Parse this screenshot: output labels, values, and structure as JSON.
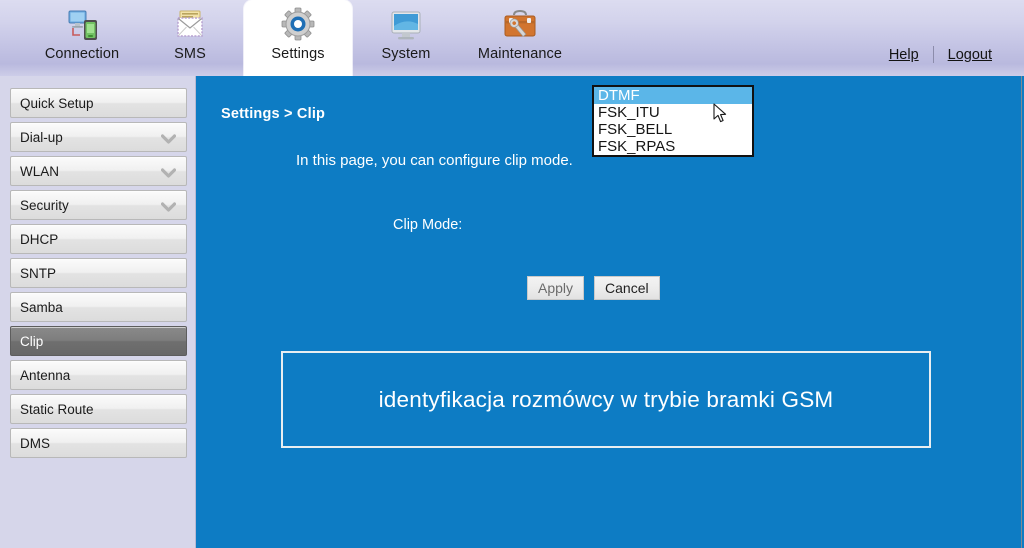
{
  "header": {
    "tabs": [
      {
        "label": "Connection",
        "icon": "network-devices-icon",
        "active": false
      },
      {
        "label": "SMS",
        "icon": "envelope-icon",
        "active": false
      },
      {
        "label": "Settings",
        "icon": "gear-icon",
        "active": true
      },
      {
        "label": "System",
        "icon": "monitor-icon",
        "active": false
      },
      {
        "label": "Maintenance",
        "icon": "toolbox-wrench-icon",
        "active": false
      }
    ],
    "help_label": "Help",
    "logout_label": "Logout"
  },
  "sidebar": {
    "items": [
      {
        "label": "Quick Setup",
        "expandable": false,
        "active": false
      },
      {
        "label": "Dial-up",
        "expandable": true,
        "active": false
      },
      {
        "label": "WLAN",
        "expandable": true,
        "active": false
      },
      {
        "label": "Security",
        "expandable": true,
        "active": false
      },
      {
        "label": "DHCP",
        "expandable": false,
        "active": false
      },
      {
        "label": "SNTP",
        "expandable": false,
        "active": false
      },
      {
        "label": "Samba",
        "expandable": false,
        "active": false
      },
      {
        "label": "Clip",
        "expandable": false,
        "active": true
      },
      {
        "label": "Antenna",
        "expandable": false,
        "active": false
      },
      {
        "label": "Static Route",
        "expandable": false,
        "active": false
      },
      {
        "label": "DMS",
        "expandable": false,
        "active": false
      }
    ]
  },
  "main": {
    "breadcrumb": "Settings > Clip",
    "intro": "In this page, you can configure clip mode.",
    "clip_mode_label": "Clip Mode:",
    "clip_mode_value": "DTMF",
    "clip_mode_options": [
      "DTMF",
      "FSK_ITU",
      "FSK_BELL",
      "FSK_RPAS"
    ],
    "apply_label": "Apply",
    "cancel_label": "Cancel",
    "annotation": "identyfikacja rozmówcy w trybie bramki GSM"
  },
  "colors": {
    "content_blue": "#0d7cc4",
    "sidebar_lavender": "#d6d6ea",
    "active_item_gray": "#757575",
    "option_highlight": "#5bb6e8"
  }
}
